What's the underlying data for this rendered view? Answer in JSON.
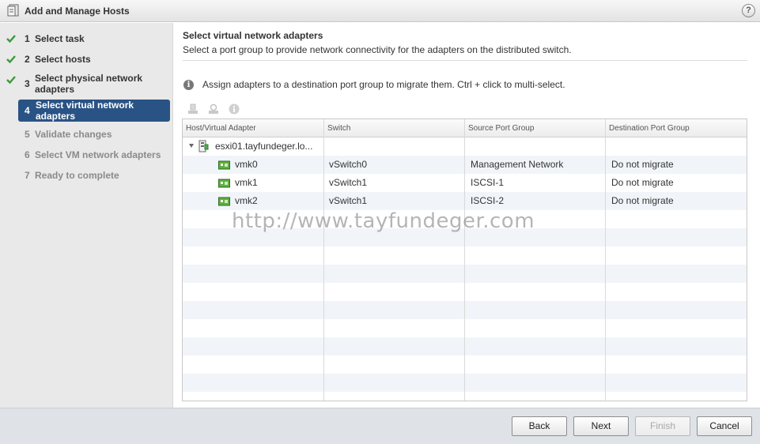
{
  "window": {
    "title": "Add and Manage Hosts",
    "help_icon": "help-icon",
    "help_label": "?"
  },
  "steps": [
    {
      "num": "1",
      "label": "Select task",
      "state": "done"
    },
    {
      "num": "2",
      "label": "Select hosts",
      "state": "done"
    },
    {
      "num": "3",
      "label": "Select physical network adapters",
      "state": "done"
    },
    {
      "num": "4",
      "label": "Select virtual network adapters",
      "state": "active"
    },
    {
      "num": "5",
      "label": "Validate changes",
      "state": "pending"
    },
    {
      "num": "6",
      "label": "Select VM network adapters",
      "state": "pending"
    },
    {
      "num": "7",
      "label": "Ready to complete",
      "state": "pending"
    }
  ],
  "page": {
    "heading": "Select virtual network adapters",
    "subheading": "Select a port group to provide network connectivity for the adapters on the distributed switch.",
    "info_text": "Assign adapters to a destination port group to migrate them. Ctrl + click to multi-select."
  },
  "toolbar": {
    "icons": [
      "assign-port-group-icon",
      "reset-changes-icon",
      "view-settings-icon"
    ]
  },
  "table": {
    "columns": [
      "Host/Virtual Adapter",
      "Switch",
      "Source Port Group",
      "Destination Port Group"
    ],
    "host": {
      "name": "esxi01.tayfundeger.lo...",
      "expanded": true
    },
    "adapters": [
      {
        "name": "vmk0",
        "switch": "vSwitch0",
        "source": "Management Network",
        "destination": "Do not migrate"
      },
      {
        "name": "vmk1",
        "switch": "vSwitch1",
        "source": "ISCSI-1",
        "destination": "Do not migrate"
      },
      {
        "name": "vmk2",
        "switch": "vSwitch1",
        "source": "ISCSI-2",
        "destination": "Do not migrate"
      }
    ]
  },
  "watermark": "http://www.tayfundeger.com",
  "buttons": {
    "back": "Back",
    "next": "Next",
    "finish": "Finish",
    "cancel": "Cancel"
  },
  "colors": {
    "active_step": "#2a5385",
    "check": "#3b9a3b",
    "row_alt": "#f1f5f9"
  }
}
